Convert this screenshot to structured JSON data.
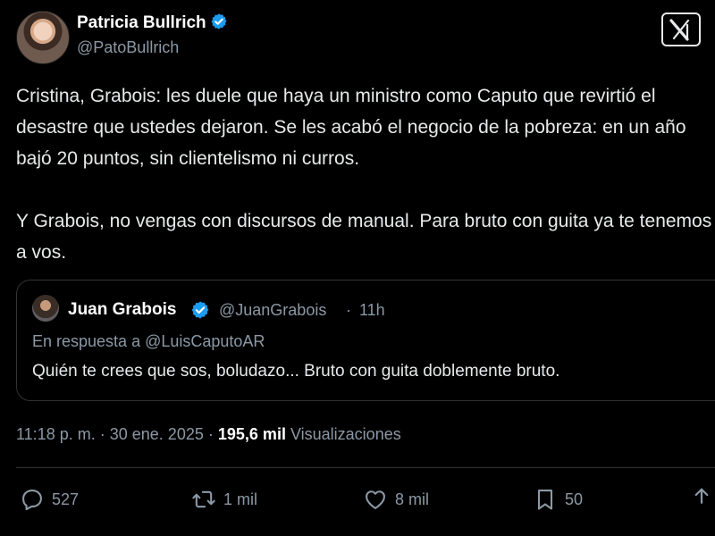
{
  "author": {
    "name": "Patricia Bullrich",
    "handle": "@PatoBullrich"
  },
  "tweet": {
    "paragraph1": "Cristina, Grabois: les duele que haya un ministro como Caputo que revirtió el desastre que ustedes dejaron. Se les acabó el negocio de la pobreza: en un año bajó 20 puntos, sin clientelismo ni curros.",
    "paragraph2": "Y Grabois, no vengas con discursos de manual. Para bruto con guita ya te tenemos a vos."
  },
  "quoted": {
    "name": "Juan Grabois",
    "handle": "@JuanGrabois",
    "separator": "·",
    "time": "11h",
    "reply_to": "En respuesta a @LuisCaputoAR",
    "text": "Quién te crees que sos, boludazo... Bruto con guita doblemente bruto."
  },
  "meta": {
    "time": "11:18 p. m.",
    "separator": "·",
    "date": "30 ene. 2025",
    "views_count": "195,6 mil",
    "views_label": "Visualizaciones"
  },
  "actions": {
    "replies": "527",
    "reposts": "1 mil",
    "likes": "8 mil",
    "bookmarks": "50"
  },
  "colors": {
    "background": "#000000",
    "text": "#e7e9ea",
    "secondary": "#8b98a5",
    "verified": "#1d9bf0",
    "border": "#2f3336"
  },
  "icons": {
    "verified": "verified-badge-icon",
    "logo": "x-logo-icon",
    "reply": "reply-icon",
    "repost": "repost-icon",
    "like": "like-icon",
    "bookmark": "bookmark-icon",
    "share": "share-icon"
  }
}
